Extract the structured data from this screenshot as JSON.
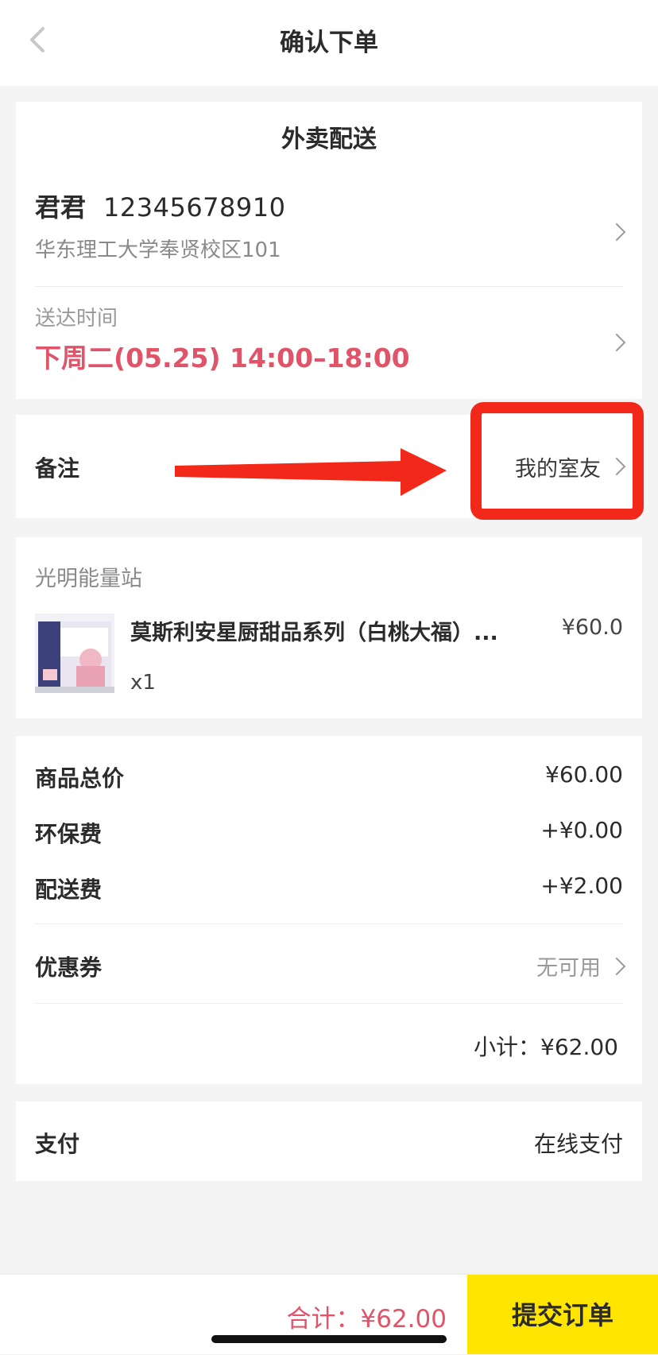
{
  "header": {
    "title": "确认下单"
  },
  "delivery": {
    "mode_title": "外卖配送",
    "contact_name": "君君",
    "contact_phone": "12345678910",
    "address": "华东理工大学奉贤校区101",
    "time_label": "送达时间",
    "time_value": "下周二(05.25) 14:00–18:00"
  },
  "note": {
    "label": "备注",
    "value": "我的室友"
  },
  "annotation": {
    "highlight_color": "#f2281b"
  },
  "shop": {
    "name": "光明能量站",
    "product_name": "莫斯利安星厨甜品系列（白桃大福）...",
    "product_price": "¥60.0",
    "product_qty": "x1"
  },
  "fees": {
    "goods_total_label": "商品总价",
    "goods_total_value": "¥60.00",
    "eco_fee_label": "环保费",
    "eco_fee_value": "+¥0.00",
    "delivery_fee_label": "配送费",
    "delivery_fee_value": "+¥2.00",
    "coupon_label": "优惠券",
    "coupon_value": "无可用",
    "subtotal": "小计：¥62.00"
  },
  "payment": {
    "label": "支付",
    "value": "在线支付"
  },
  "footer": {
    "total": "合计：¥62.00",
    "submit_label": "提交订单"
  },
  "colors": {
    "accent_yellow": "#ffe500",
    "price_red": "#e0546a"
  }
}
